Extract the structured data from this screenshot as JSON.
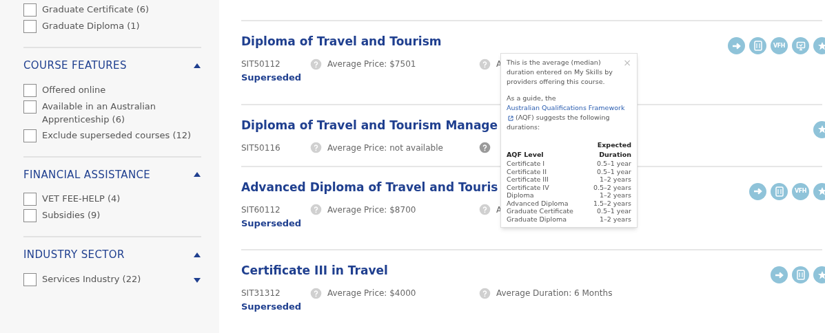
{
  "sidebar": {
    "top_items": [
      {
        "label": "Graduate Certificate (6)",
        "checked": false
      },
      {
        "label": "Graduate Diploma (1)",
        "checked": false
      }
    ],
    "sections": [
      {
        "title": "COURSE FEATURES",
        "expanded": true,
        "items": [
          {
            "label": "Offered online",
            "checked": false
          },
          {
            "label": "Available in an Australian Apprenticeship (6)",
            "checked": false
          },
          {
            "label": "Exclude superseded courses (12)",
            "checked": false
          }
        ]
      },
      {
        "title": "FINANCIAL ASSISTANCE",
        "expanded": true,
        "items": [
          {
            "label": "VET FEE-HELP (4)",
            "checked": false
          },
          {
            "label": "Subsidies (9)",
            "checked": false
          }
        ]
      },
      {
        "title": "INDUSTRY SECTOR",
        "expanded": true,
        "scroll_down": true,
        "items": [
          {
            "label": "Services Industry (22)",
            "checked": false
          }
        ]
      }
    ]
  },
  "courses": [
    {
      "title": "Diploma of Travel and Tourism",
      "code": "SIT50112",
      "price": "Average Price: $7501",
      "duration": "A",
      "duration_help_active": false,
      "status": "Superseded",
      "actions": [
        {
          "kind": "arrow"
        },
        {
          "kind": "calculator"
        },
        {
          "kind": "badge",
          "label": "VFH"
        },
        {
          "kind": "monitor"
        },
        {
          "kind": "star"
        }
      ]
    },
    {
      "title": "Diploma of Travel and Tourism Manage",
      "code": "SIT50116",
      "price": "Average Price: not available",
      "duration_help_active": true,
      "actions": [
        {
          "kind": "star"
        }
      ]
    },
    {
      "title": "Advanced Diploma of Travel and Touris",
      "code": "SIT60112",
      "price": "Average Price: $8700",
      "duration": "A",
      "duration_help_active": false,
      "status": "Superseded",
      "actions": [
        {
          "kind": "arrow"
        },
        {
          "kind": "calculator"
        },
        {
          "kind": "badge",
          "label": "VFH"
        },
        {
          "kind": "star"
        }
      ]
    },
    {
      "title": "Certificate III in Travel",
      "code": "SIT31312",
      "price": "Average Price: $4000",
      "duration": "Average Duration: 6 Months",
      "duration_help_active": false,
      "status": "Superseded",
      "actions": [
        {
          "kind": "arrow"
        },
        {
          "kind": "calculator"
        },
        {
          "kind": "star"
        }
      ]
    }
  ],
  "tooltip": {
    "close": "×",
    "intro": "This is the average (median) duration entered on My Skills by providers offering this course.",
    "guide_before": "As a guide, the",
    "link": "Australian Qualifications Framework",
    "guide_after": "(AQF) suggests the following durations:",
    "columns": [
      "AQF Level",
      "Expected Duration"
    ],
    "rows": [
      [
        "Certificate I",
        "0.5–1 year"
      ],
      [
        "Certificate II",
        "0.5–1 year"
      ],
      [
        "Certificate III",
        "1–2 years"
      ],
      [
        "Certificate IV",
        "0.5–2 years"
      ],
      [
        "Diploma",
        "1–2 years"
      ],
      [
        "Advanced Diploma",
        "1.5–2 years"
      ],
      [
        "Graduate Certificate",
        "0.5–1 year"
      ],
      [
        "Graduate Diploma",
        "1–2 years"
      ]
    ]
  }
}
